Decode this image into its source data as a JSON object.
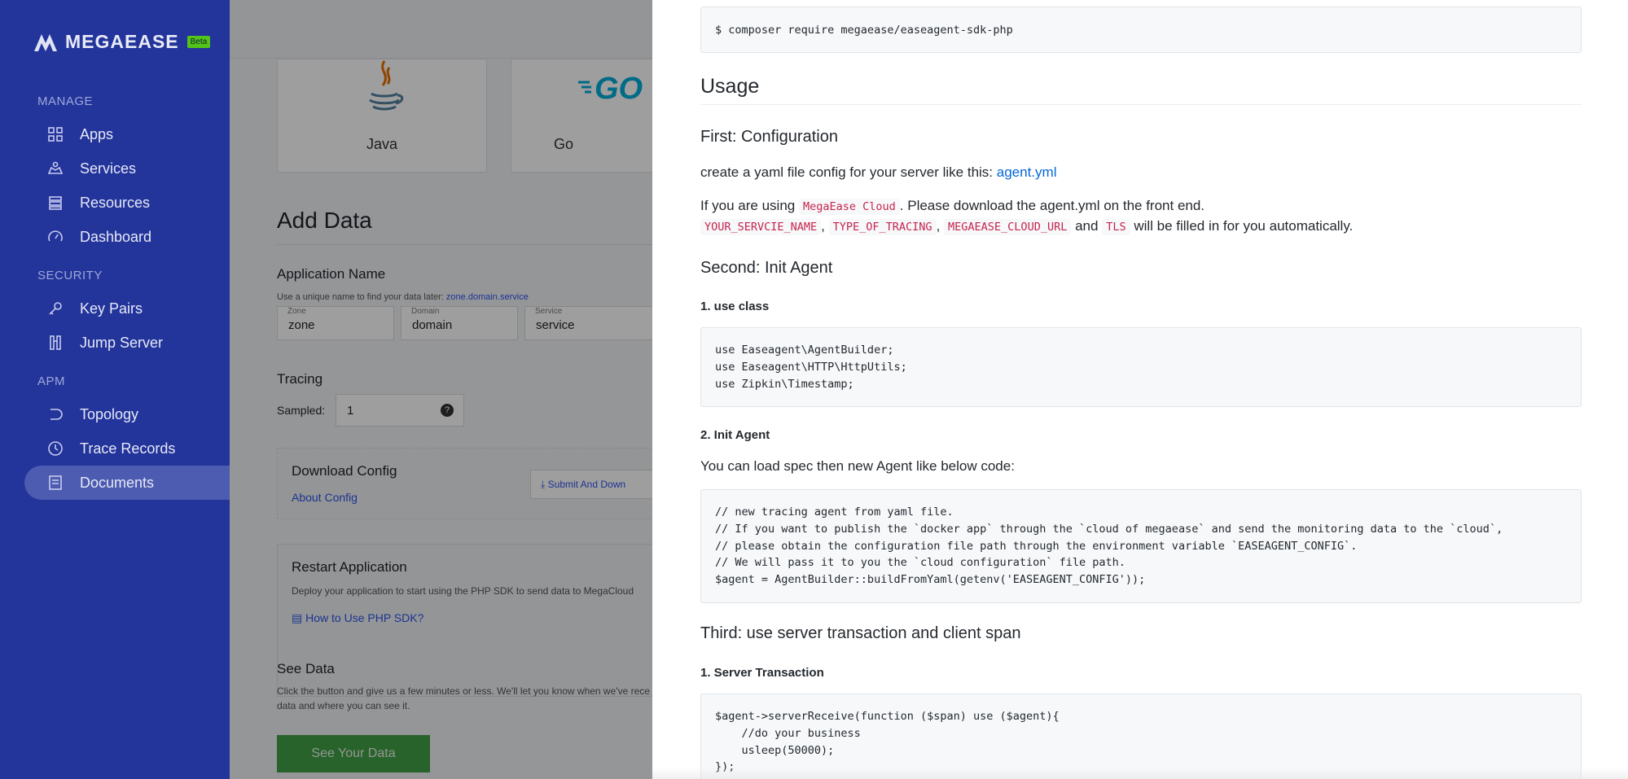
{
  "sidebar": {
    "logo": "MEGAEASE",
    "beta": "Beta",
    "sections": {
      "manage": "MANAGE",
      "security": "SECURITY",
      "apm": "APM"
    },
    "items": [
      {
        "label": "Apps",
        "icon": "grid-icon"
      },
      {
        "label": "Services",
        "icon": "services-icon"
      },
      {
        "label": "Resources",
        "icon": "resources-icon"
      },
      {
        "label": "Dashboard",
        "icon": "dashboard-icon"
      },
      {
        "label": "Key Pairs",
        "icon": "key-icon"
      },
      {
        "label": "Jump Server",
        "icon": "jump-server-icon"
      },
      {
        "label": "Topology",
        "icon": "topology-icon"
      },
      {
        "label": "Trace Records",
        "icon": "clock-icon"
      },
      {
        "label": "Documents",
        "icon": "document-icon"
      }
    ],
    "active": "Documents"
  },
  "main": {
    "languages": [
      "Java",
      "Go"
    ],
    "add_data_title": "Add Data",
    "app_name_label": "Application Name",
    "app_name_hint": "Use a unique name to find your data later:",
    "app_name_example": "zone.domain.service",
    "fields": [
      {
        "label": "Zone",
        "value": "zone"
      },
      {
        "label": "Domain",
        "value": "domain"
      },
      {
        "label": "Service",
        "value": "service"
      }
    ],
    "tracing_label": "Tracing",
    "sampled_label": "Sampled:",
    "sampled_value": "1",
    "download_config": "Download Config",
    "about_config": "About Config",
    "submit_download": "Submit And Down",
    "restart_title": "Restart Application",
    "restart_desc": "Deploy your application to start using the PHP SDK to send data to MegaCloud",
    "how_to_link": "How to Use PHP SDK?",
    "see_data_title": "See Data",
    "see_data_desc_1": "Click the button and give us a few minutes or less. We'll let you know when we've rece",
    "see_data_desc_2": "data and where you can see it.",
    "see_data_button": "See Your Data"
  },
  "drawer": {
    "install_cmd": "$ composer require megaease/easeagent-sdk-php",
    "usage_title": "Usage",
    "first_title": "First: Configuration",
    "first_text": "create a yaml file config for your server like this:",
    "first_link": "agent.yml",
    "cloud_text_1": "If you are using",
    "cloud_code": "MegaEase Cloud",
    "cloud_text_2": ". Please download the agent.yml on the front end.",
    "vars": [
      "YOUR_SERVCIE_NAME",
      "TYPE_OF_TRACING",
      "MEGAEASE_CLOUD_URL",
      "TLS"
    ],
    "vars_sep": ",",
    "vars_and": "and",
    "vars_tail": "will be filled in for you automatically.",
    "second_title": "Second: Init Agent",
    "use_class_title": "1. use class",
    "use_class_code": "use Easeagent\\AgentBuilder;\nuse Easeagent\\HTTP\\HttpUtils;\nuse Zipkin\\Timestamp;",
    "init_agent_title": "2. Init Agent",
    "init_agent_text": "You can load spec then new Agent like below code:",
    "init_agent_code": "// new tracing agent from yaml file.\n// If you want to publish the `docker app` through the `cloud of megaease` and send the monitoring data to the `cloud`,\n// please obtain the configuration file path through the environment variable `EASEAGENT_CONFIG`.\n// We will pass it to you the `cloud configuration` file path.\n$agent = AgentBuilder::buildFromYaml(getenv('EASEAGENT_CONFIG'));",
    "third_title": "Third: use server transaction and client span",
    "server_tx_title": "1. Server Transaction",
    "server_tx_code": "$agent->serverReceive(function ($span) use ($agent){\n    //do your business\n    usleep(50000);\n});"
  }
}
